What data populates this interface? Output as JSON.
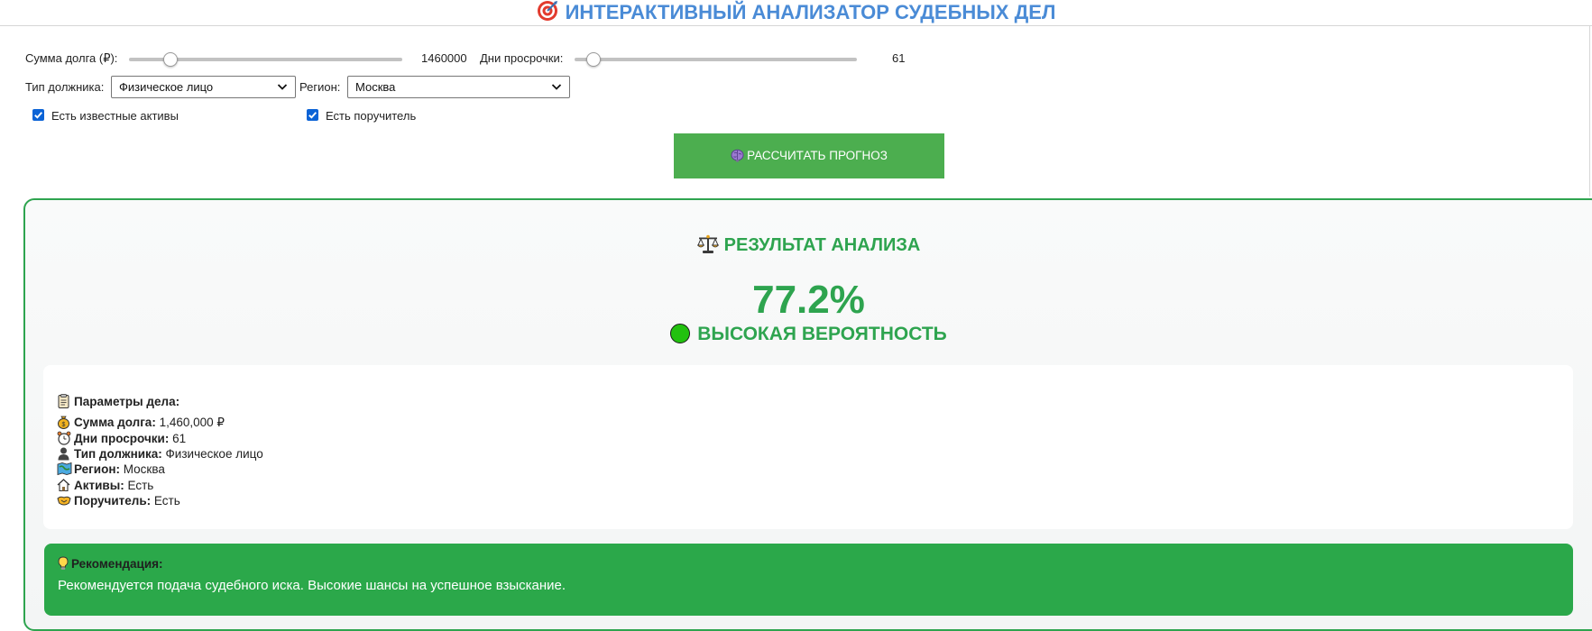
{
  "header": {
    "title": "ИНТЕРАКТИВНЫЙ АНАЛИЗАТОР СУДЕБНЫХ ДЕЛ",
    "icon": "target-icon",
    "accent_color": "#4a8bd6"
  },
  "controls": {
    "debt_amount": {
      "label": "Сумма долга (₽):",
      "value": "1460000",
      "slider_fraction": 0.15
    },
    "overdue_days": {
      "label": "Дни просрочки:",
      "value": "61",
      "slider_fraction": 0.06
    },
    "debtor_type": {
      "label": "Тип должника:",
      "selected": "Физическое лицо"
    },
    "region": {
      "label": "Регион:",
      "selected": "Москва"
    },
    "has_assets": {
      "label": "Есть известные активы",
      "checked": true
    },
    "has_guarantor": {
      "label": "Есть поручитель",
      "checked": true
    },
    "calculate_button": {
      "label": "РАССЧИТАТЬ ПРОГНОЗ",
      "icon": "brain-icon",
      "color": "#4cae4f"
    }
  },
  "result": {
    "title": "РЕЗУЛЬТАТ АНАЛИЗА",
    "title_icon": "scales-icon",
    "percentage": "77.2%",
    "probability_label": "ВЫСОКАЯ ВЕРОЯТНОСТЬ",
    "probability_icon": "green-circle-icon",
    "accent_color": "#2ea44f",
    "params": {
      "heading": "Параметры дела:",
      "debt_key": "Сумма долга:",
      "debt_val": "1,460,000 ₽",
      "days_key": "Дни просрочки:",
      "days_val": "61",
      "type_key": "Тип должника:",
      "type_val": "Физическое лицо",
      "region_key": "Регион:",
      "region_val": "Москва",
      "assets_key": "Активы:",
      "assets_val": "Есть",
      "guarantor_key": "Поручитель:",
      "guarantor_val": "Есть"
    },
    "recommendation": {
      "title": "Рекомендация:",
      "text": "Рекомендуется подача судебного иска. Высокие шансы на успешное взыскание.",
      "color": "#2ba84a"
    }
  }
}
